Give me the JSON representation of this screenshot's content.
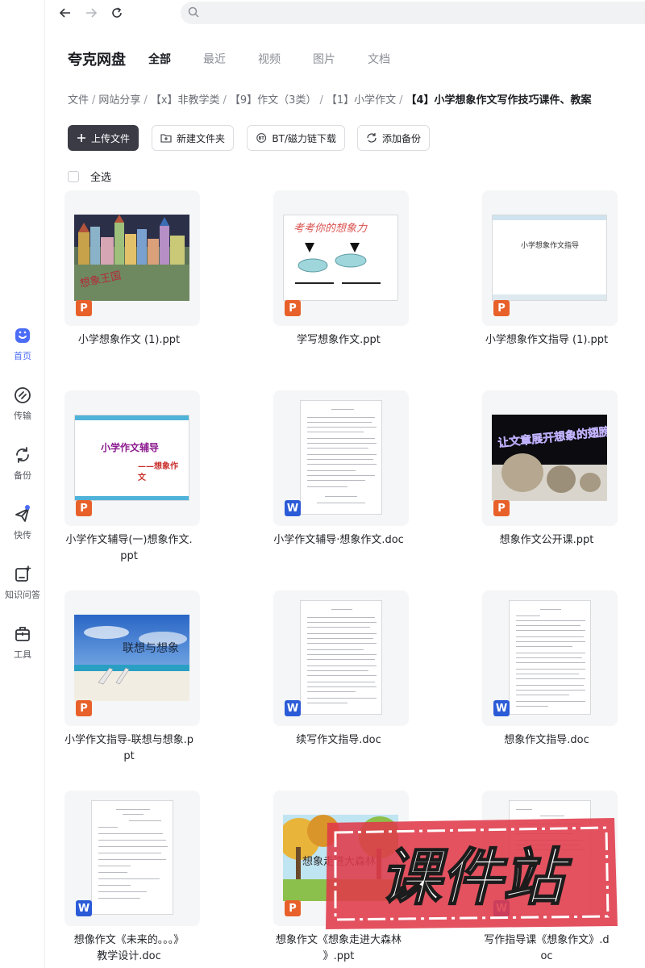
{
  "brand": {
    "name": "夸克网盘"
  },
  "tabs": [
    "全部",
    "最近",
    "视频",
    "图片",
    "文档"
  ],
  "breadcrumb": [
    "文件",
    "网站分享",
    "【x】非教学类",
    "【9】作文（3类）",
    "【1】小学作文",
    "【4】小学想象作文写作技巧课件、教案"
  ],
  "toolbar": {
    "upload": "上传文件",
    "new_folder": "新建文件夹",
    "bt": "BT/磁力链下载",
    "backup": "添加备份"
  },
  "select_all": "全选",
  "sidebar": [
    "首页",
    "传输",
    "备份",
    "快传",
    "知识问答",
    "工具"
  ],
  "files": [
    {
      "name1": "小学想象作文 (1).ppt",
      "name2": "",
      "type": "P",
      "thumb_text": "想象王国"
    },
    {
      "name1": "学写想象作文.ppt",
      "name2": "",
      "type": "P",
      "thumb_text": "考考你的想象力"
    },
    {
      "name1": "小学想象作文指导 (1).ppt",
      "name2": "",
      "type": "P",
      "thumb_text": "小学想象作文指导"
    },
    {
      "name1": "小学作文辅导(一)想象作文.",
      "name2": "ppt",
      "type": "P",
      "thumb_text": "小学作文辅导",
      "thumb_text2": "——想象作",
      "thumb_text3": "文"
    },
    {
      "name1": "小学作文辅导·想象作文.doc",
      "name2": "",
      "type": "W",
      "thumb_text": ""
    },
    {
      "name1": "想象作文公开课.ppt",
      "name2": "",
      "type": "P",
      "thumb_text": "让文章展开想象的翅膀"
    },
    {
      "name1": "小学作文指导-联想与想象.p",
      "name2": "pt",
      "type": "P",
      "thumb_text": "联想与想象"
    },
    {
      "name1": "续写作文指导.doc",
      "name2": "",
      "type": "W",
      "thumb_text": ""
    },
    {
      "name1": "想象作文指导.doc",
      "name2": "",
      "type": "W",
      "thumb_text": ""
    },
    {
      "name1": "想像作文《未来的。。。》",
      "name2": "教学设计.doc",
      "type": "W",
      "thumb_text": ""
    },
    {
      "name1": "想象作文《想象走进大森林",
      "name2": "》.ppt",
      "type": "P",
      "thumb_text": "想象走进大森林"
    },
    {
      "name1": "写作指导课《想象作文》.d",
      "name2": "oc",
      "type": "W",
      "thumb_text": ""
    }
  ],
  "watermark": "课件站",
  "colors": {
    "accent": "#4a6cf7",
    "ppt_badge": "#e8612a",
    "word_badge": "#2b5bd7",
    "watermark": "#e03a4a"
  }
}
